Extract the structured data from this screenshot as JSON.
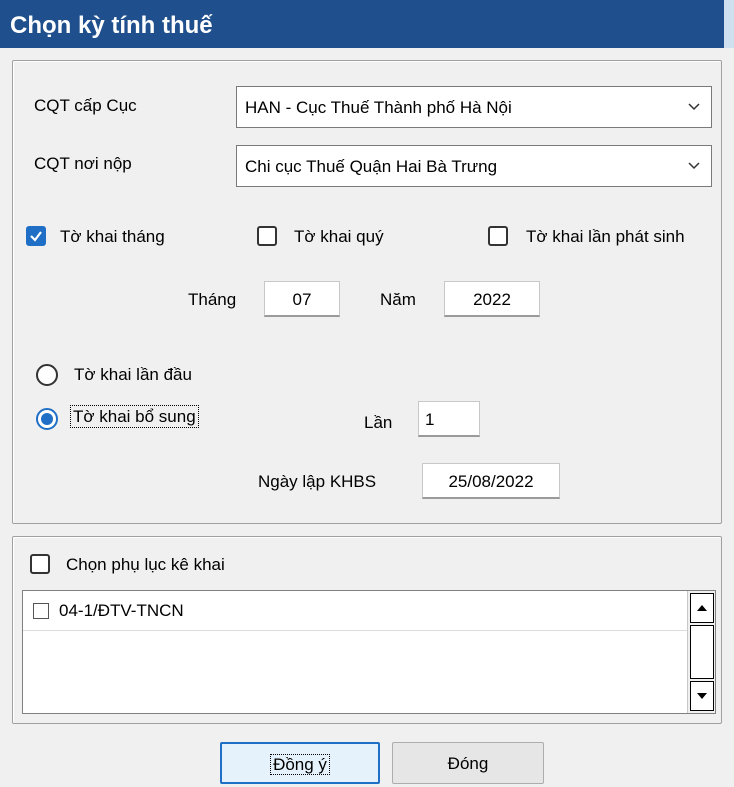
{
  "window": {
    "title": "Chọn kỳ tính thuế"
  },
  "tax_office": {
    "level_label": "CQT cấp Cục",
    "level_value": "HAN - Cục Thuế Thành phố Hà Nội",
    "submit_label": "CQT nơi nộp",
    "submit_value": "Chi cục Thuế Quận Hai Bà Trưng"
  },
  "declaration_type": {
    "monthly": {
      "label": "Tờ khai tháng",
      "checked": true
    },
    "quarterly": {
      "label": "Tờ khai quý",
      "checked": false
    },
    "per_occurrence": {
      "label": "Tờ khai lần phát sinh",
      "checked": false
    }
  },
  "period": {
    "month_label": "Tháng",
    "month_value": "07",
    "year_label": "Năm",
    "year_value": "2022"
  },
  "submission": {
    "first_label": "Tờ khai lần đầu",
    "supplement_label": "Tờ khai bổ sung",
    "selected": "supplement",
    "times_label": "Lần",
    "times_value": "1",
    "date_label": "Ngày lập KHBS",
    "date_value": "25/08/2022"
  },
  "appendix": {
    "select_label": "Chọn phụ lục kê khai",
    "checked": false,
    "items": [
      {
        "label": "04-1/ĐTV-TNCN",
        "checked": false
      }
    ]
  },
  "buttons": {
    "ok_label": "Đồng ý",
    "close_label": "Đóng"
  },
  "colors": {
    "title_bar": "#1f4f8c",
    "accent": "#1f6fc6"
  }
}
